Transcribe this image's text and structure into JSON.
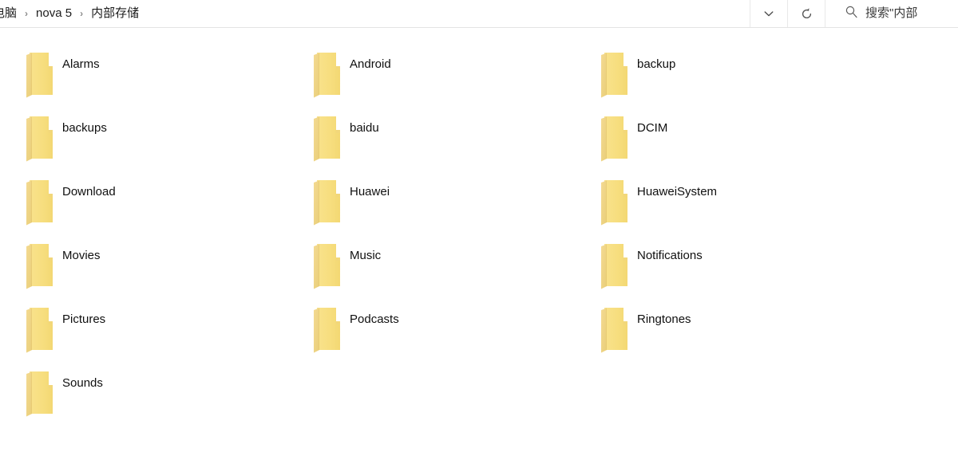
{
  "addressbar": {
    "breadcrumb": [
      {
        "label": "电脑"
      },
      {
        "label": "nova 5"
      },
      {
        "label": "内部存储"
      }
    ],
    "separator": "›",
    "history_dropdown_label": "",
    "refresh_label": "",
    "search": {
      "placeholder": "搜索\"内部"
    }
  },
  "colors": {
    "folder_body": "#F7DE7F",
    "folder_flap": "#F2D88C",
    "folder_flap_dark": "#E8CE76",
    "folder_edge": "#EBD182",
    "text": "#101010",
    "separator": "#8a8a8a",
    "border": "#e4e4e4"
  },
  "files": [
    {
      "name": "Alarms",
      "type": "folder"
    },
    {
      "name": "Android",
      "type": "folder"
    },
    {
      "name": "backup",
      "type": "folder"
    },
    {
      "name": "backups",
      "type": "folder"
    },
    {
      "name": "baidu",
      "type": "folder"
    },
    {
      "name": "DCIM",
      "type": "folder"
    },
    {
      "name": "Download",
      "type": "folder"
    },
    {
      "name": "Huawei",
      "type": "folder"
    },
    {
      "name": "HuaweiSystem",
      "type": "folder"
    },
    {
      "name": "Movies",
      "type": "folder"
    },
    {
      "name": "Music",
      "type": "folder"
    },
    {
      "name": "Notifications",
      "type": "folder"
    },
    {
      "name": "Pictures",
      "type": "folder"
    },
    {
      "name": "Podcasts",
      "type": "folder"
    },
    {
      "name": "Ringtones",
      "type": "folder"
    },
    {
      "name": "Sounds",
      "type": "folder"
    }
  ]
}
